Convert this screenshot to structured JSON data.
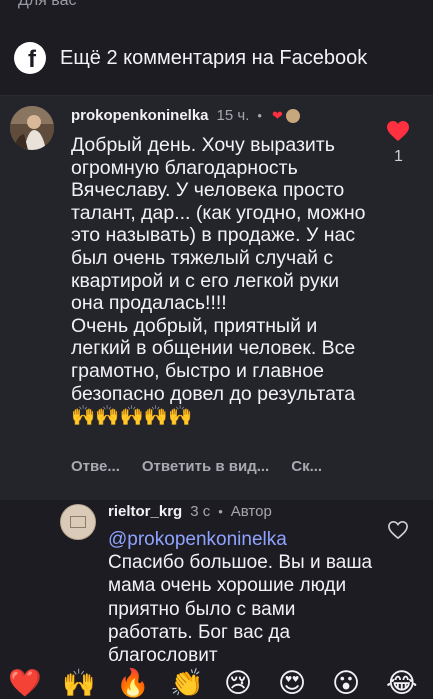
{
  "top_fragment": "Для вас",
  "facebook": {
    "label": "Ещё 2 комментария на Facebook"
  },
  "comment": {
    "username": "prokopenkoninelka",
    "time": "15 ч.",
    "separator": "•",
    "text": "Добрый день. Хочу выразить огромную благодарность Вячеславу. У человека просто талант, дар... (как угодно, можно это называть) в продаже. У нас был очень тяжелый случай с квартирой и с его легкой руки она продалась!!!!\nОчень добрый, приятный и легкий в общении человек. Все грамотно, быстро и главное безопасно довел до результата🙌🙌🙌🙌🙌",
    "like_count": "1",
    "liked": true,
    "actions": [
      "Отве...",
      "Ответить в вид...",
      "Ск..."
    ]
  },
  "reply": {
    "username": "rieltor_krg",
    "time": "3 с",
    "separator": "•",
    "author_label": "Автор",
    "mention": "@prokopenkoninelka",
    "text": "Спасибо большое. Вы и ваша мама очень хорошие люди приятно было с вами работать. Бог вас да благословит"
  },
  "emoji_bar": [
    "❤️",
    "🙌",
    "🔥",
    "👏",
    "😢",
    "😍",
    "😮",
    "😂"
  ],
  "colors": {
    "background": "#1c1c22",
    "comment_highlight": "#24242b",
    "like_red": "#ff3040",
    "mention_blue": "#8fa2ff",
    "muted_text": "#a6a6ad"
  }
}
